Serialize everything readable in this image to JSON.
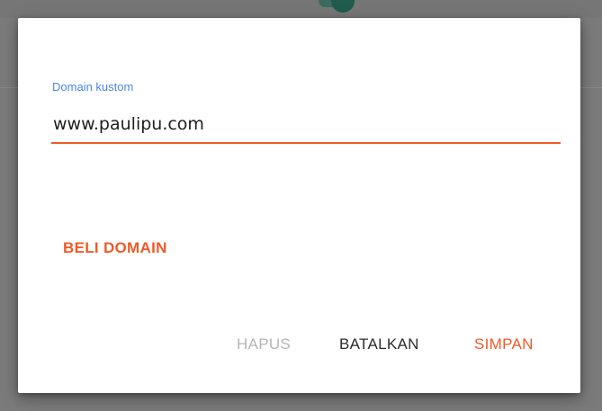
{
  "dialog": {
    "field_label": "Domain kustom",
    "field_value": "www.paulipu.com",
    "buy_domain_label": "BELI DOMAIN",
    "delete_label": "HAPUS",
    "cancel_label": "BATALKAN",
    "save_label": "SIMPAN"
  },
  "colors": {
    "accent": "#f05a28",
    "label_blue": "#4a86e8",
    "disabled_text": "#b5b5b5",
    "backdrop": "#7b7b7b"
  }
}
